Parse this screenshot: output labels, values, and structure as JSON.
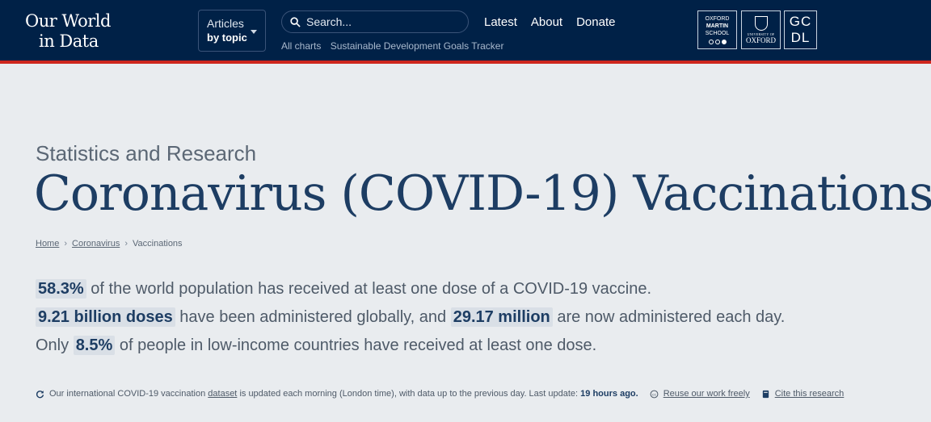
{
  "header": {
    "logo_line1": "Our World",
    "logo_line2": "in Data",
    "topics": {
      "line1": "Articles",
      "line2": "by topic"
    },
    "search_placeholder": "Search...",
    "subnav": [
      "All charts",
      "Sustainable Development Goals Tracker"
    ],
    "nav": [
      "Latest",
      "About",
      "Donate"
    ],
    "partners": {
      "oms": [
        "OXFORD",
        "MARTIN",
        "SCHOOL"
      ],
      "oxford": {
        "small": "UNIVERSITY OF",
        "name": "OXFORD"
      },
      "gcdl": [
        "GC",
        "DL"
      ]
    },
    "colors": {
      "bg": "#002147",
      "accent": "#ce261e"
    }
  },
  "page": {
    "supertitle": "Statistics and Research",
    "title": "Coronavirus (COVID-19) Vaccinations",
    "breadcrumb": [
      "Home",
      "Coronavirus",
      "Vaccinations"
    ]
  },
  "stats": {
    "line1": {
      "value": "58.3%",
      "text": "of the world population has received at least one dose of a COVID-19 vaccine."
    },
    "line2": {
      "value1": "9.21 billion doses",
      "mid": "have been administered globally, and",
      "value2": "29.17 million",
      "end": "are now administered each day."
    },
    "line3": {
      "start": "Only",
      "value": "8.5%",
      "end": "of people in low-income countries have received at least one dose."
    }
  },
  "footer": {
    "prefix": "Our international COVID-19 vaccination",
    "dataset_link": "dataset",
    "middle": "is updated each morning (London time), with data up to the previous day. Last update:",
    "last_update": "19 hours ago.",
    "reuse_link": "Reuse our work freely",
    "cite_link": "Cite this research"
  }
}
